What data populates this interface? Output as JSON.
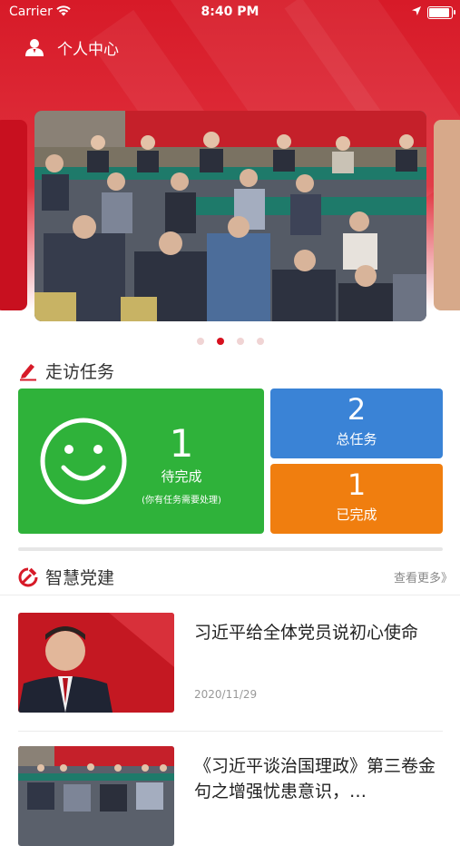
{
  "status_bar": {
    "carrier": "Carrier",
    "time": "8:40 PM"
  },
  "profile": {
    "label": "个人中心"
  },
  "carousel": {
    "active_index": 1,
    "count": 4
  },
  "visit_section": {
    "title": "走访任务",
    "pending": {
      "count": "1",
      "label": "待完成",
      "note": "(你有任务需要处理)"
    },
    "total": {
      "count": "2",
      "label": "总任务"
    },
    "completed": {
      "count": "1",
      "label": "已完成"
    }
  },
  "party_section": {
    "title": "智慧党建",
    "more_label": "查看更多》",
    "news": [
      {
        "title": "习近平给全体党员说初心使命",
        "date": "2020/11/29"
      },
      {
        "title": "《习近平谈治国理政》第三卷金句之增强忧患意识，…"
      }
    ]
  },
  "colors": {
    "brand_red": "#d71a28",
    "pending_green": "#2fb23a",
    "total_blue": "#3a83d6",
    "done_orange": "#f07e0f"
  },
  "icons": {
    "profile": "person-icon",
    "visit": "pen-icon",
    "party": "hammer-sickle-icon"
  }
}
